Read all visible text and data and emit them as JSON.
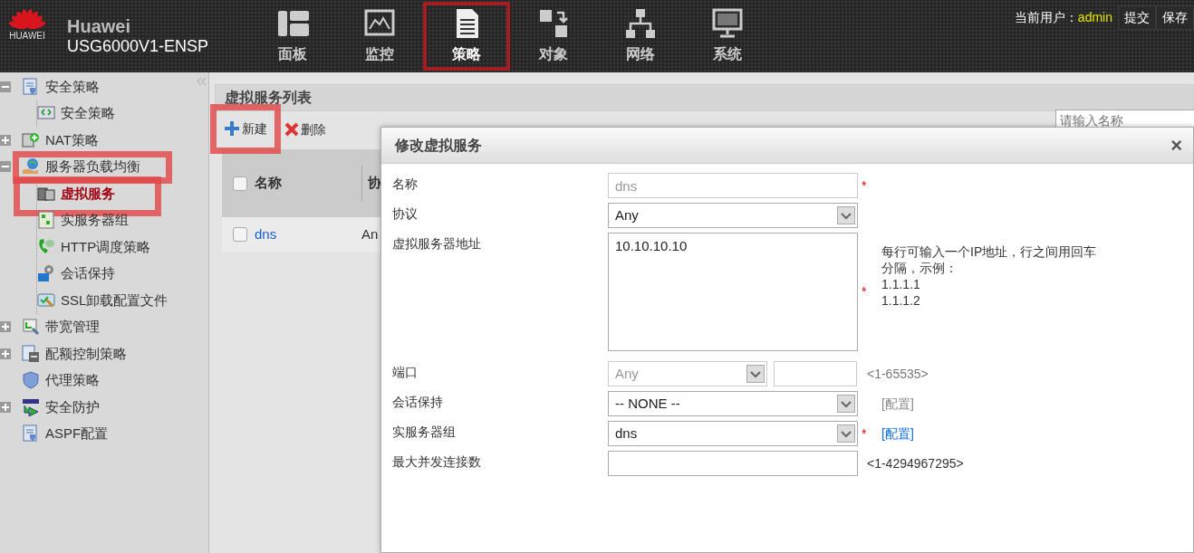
{
  "header": {
    "brand": "HUAWEI",
    "product": "Huawei",
    "model": "USG6000V1-ENSP",
    "nav": [
      {
        "label": "面板",
        "selected": false,
        "highlighted": false
      },
      {
        "label": "监控",
        "selected": false,
        "highlighted": false
      },
      {
        "label": "策略",
        "selected": true,
        "highlighted": true
      },
      {
        "label": "对象",
        "selected": false,
        "highlighted": false
      },
      {
        "label": "网络",
        "selected": false,
        "highlighted": false
      },
      {
        "label": "系统",
        "selected": false,
        "highlighted": false
      }
    ],
    "user_label": "当前用户：",
    "user": "admin",
    "actions": [
      "提交",
      "保存"
    ]
  },
  "sidebar": {
    "items": [
      {
        "label": "安全策略",
        "kind": "folder",
        "expanded": true,
        "selected": false,
        "highlighted": false,
        "children": [
          {
            "label": "安全策略",
            "selected": false,
            "highlighted": false
          }
        ]
      },
      {
        "label": "NAT策略",
        "kind": "folder",
        "expanded": false,
        "selected": false,
        "highlighted": false
      },
      {
        "label": "服务器负载均衡",
        "kind": "folder",
        "expanded": true,
        "selected": false,
        "highlighted": true,
        "children": [
          {
            "label": "虚拟服务",
            "selected": true,
            "highlighted": true
          },
          {
            "label": "实服务器组",
            "selected": false,
            "highlighted": false
          },
          {
            "label": "HTTP调度策略",
            "selected": false,
            "highlighted": false
          },
          {
            "label": "会话保持",
            "selected": false,
            "highlighted": false
          },
          {
            "label": "SSL卸载配置文件",
            "selected": false,
            "highlighted": false
          }
        ]
      },
      {
        "label": "带宽管理",
        "kind": "folder",
        "expanded": false,
        "selected": false,
        "highlighted": false
      },
      {
        "label": "配额控制策略",
        "kind": "folder",
        "expanded": false,
        "selected": false,
        "highlighted": false
      },
      {
        "label": "代理策略",
        "kind": "leaf",
        "selected": false,
        "highlighted": false
      },
      {
        "label": "安全防护",
        "kind": "folder",
        "expanded": false,
        "selected": false,
        "highlighted": false
      },
      {
        "label": "ASPF配置",
        "kind": "leaf",
        "selected": false,
        "highlighted": false
      }
    ]
  },
  "panel": {
    "title": "虚拟服务列表",
    "toolbar": [
      {
        "label": "新建",
        "kind": "add",
        "highlighted": true
      },
      {
        "label": "删除",
        "kind": "delete",
        "highlighted": false
      }
    ],
    "search": {
      "placeholder": "请输入名称"
    },
    "table": {
      "select_all_checked": false,
      "columns": [
        "名称",
        "协"
      ],
      "rows": [
        {
          "cells": [
            "dns",
            "An"
          ],
          "checked": false
        }
      ]
    }
  },
  "dialog": {
    "title": "修改虚拟服务",
    "close": "×",
    "required_mark": "*",
    "fields": [
      {
        "label": "名称",
        "kind": "text",
        "value": "dns",
        "disabled": true,
        "required": true
      },
      {
        "label": "协议",
        "kind": "select",
        "value": "Any",
        "disabled": false,
        "required": false
      },
      {
        "label": "虚拟服务器地址",
        "kind": "textarea",
        "value": "10.10.10.10",
        "disabled": false,
        "required": true,
        "hint": "每行可输入一个IP地址，行之间用回车分隔，示例：",
        "examples": [
          "1.1.1.1",
          "1.1.1.2"
        ]
      },
      {
        "label": "端口",
        "kind": "port",
        "value": "Any",
        "disabled": true,
        "required": false,
        "range": "<1-65535>"
      },
      {
        "label": "会话保持",
        "kind": "select",
        "value": "-- NONE --",
        "disabled": false,
        "required": false,
        "link": "[配置]",
        "link_enabled": false
      },
      {
        "label": "实服务器组",
        "kind": "select",
        "value": "dns",
        "disabled": false,
        "required": true,
        "link": "[配置]",
        "link_enabled": true
      },
      {
        "label": "最大并发连接数",
        "kind": "text",
        "disabled": false,
        "required": false,
        "range": "<1-4294967295>"
      }
    ]
  }
}
